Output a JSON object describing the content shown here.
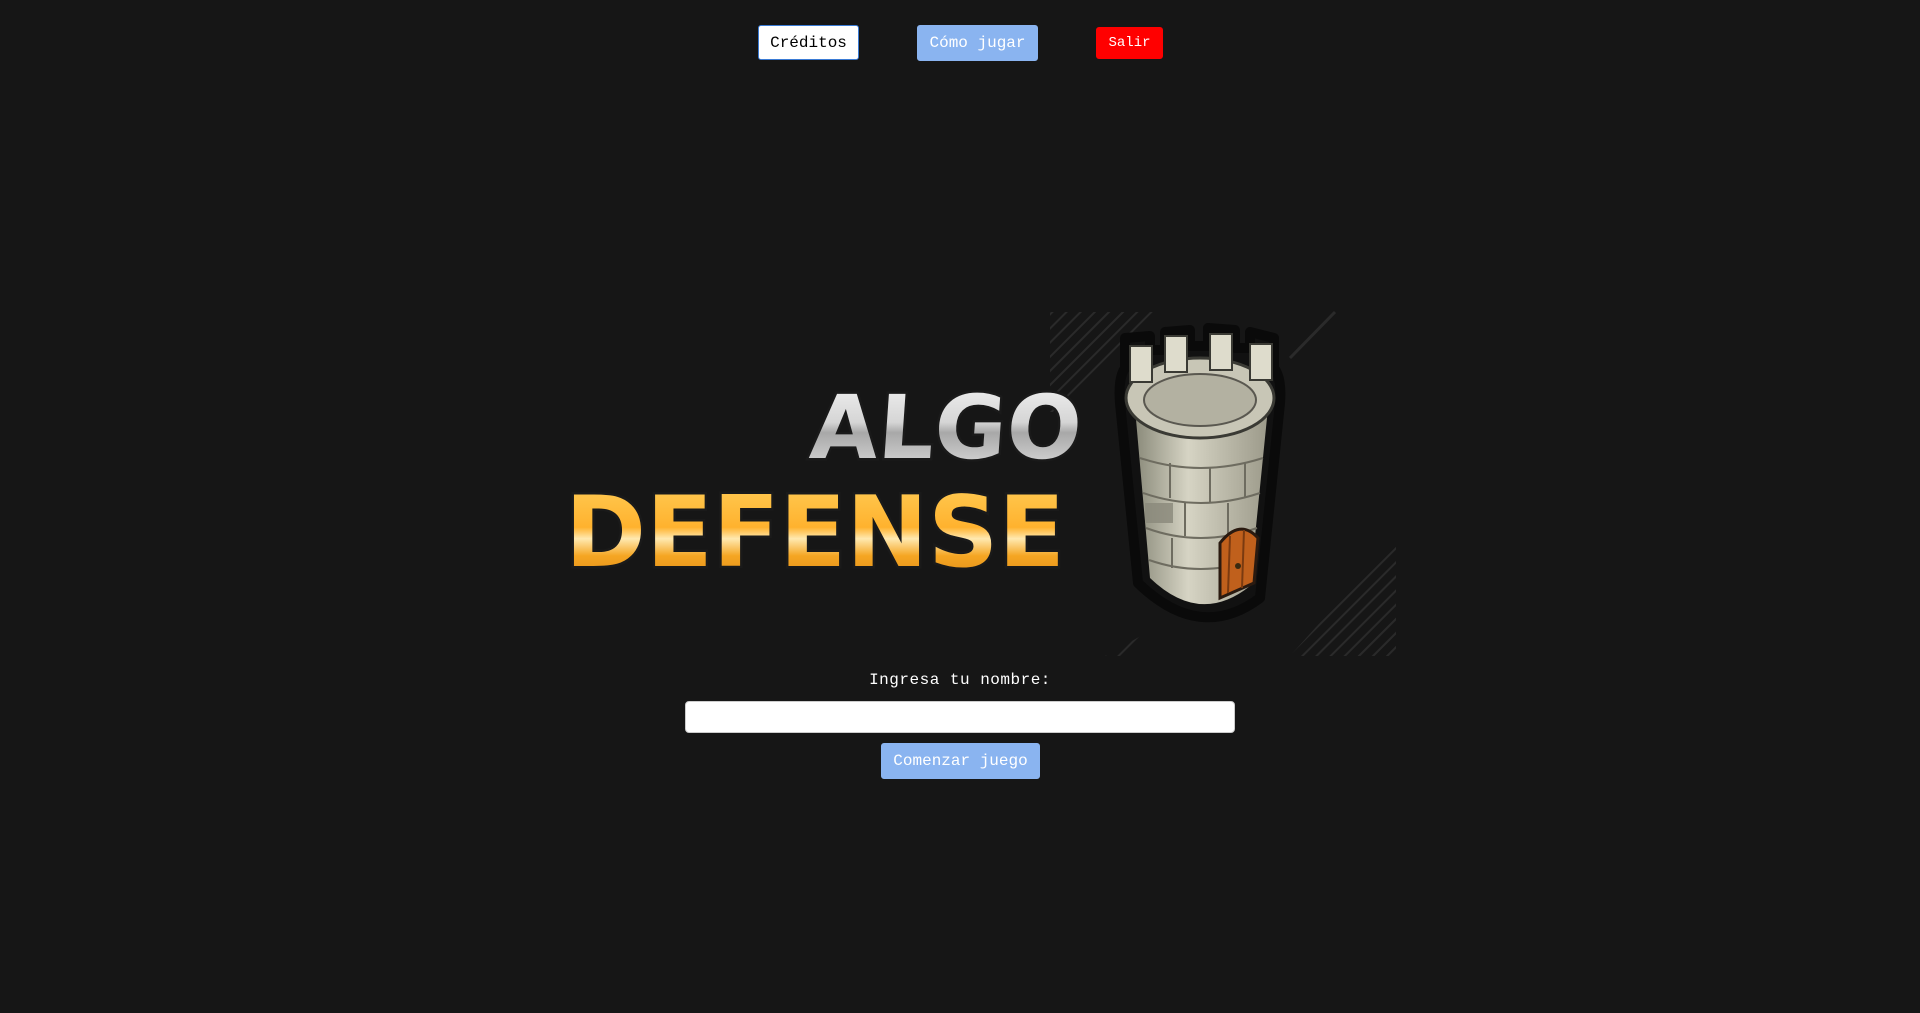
{
  "nav": {
    "creditos_label": "Créditos",
    "como_jugar_label": "Cómo jugar",
    "salir_label": "Salir"
  },
  "logo": {
    "line1": "ALGO",
    "line2": "DEFENSE",
    "icon": "castle-tower-icon"
  },
  "form": {
    "name_label": "Ingresa tu nombre:",
    "name_value": "",
    "name_placeholder": "",
    "start_label": "Comenzar juego"
  },
  "colors": {
    "background": "#161616",
    "primary_button": "#8ab4f0",
    "danger_button": "#ff0000",
    "logo_orange": "#f5a623",
    "logo_silver": "#d9d9d9"
  }
}
